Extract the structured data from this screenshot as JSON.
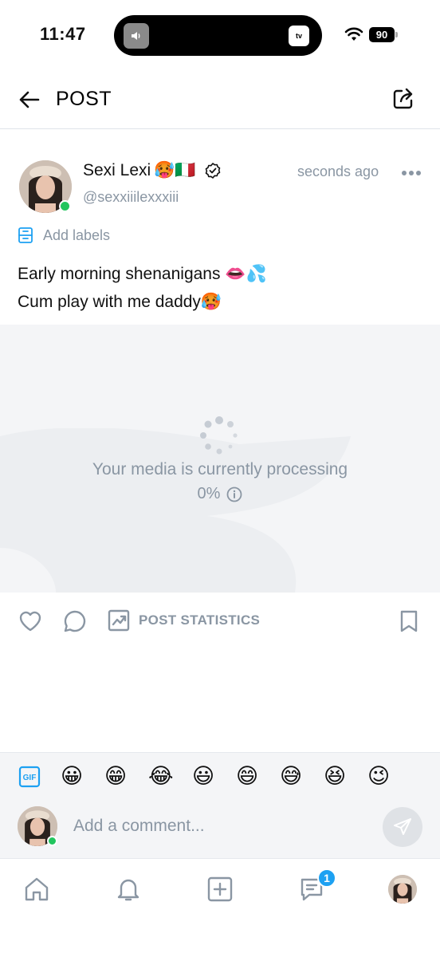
{
  "status_bar": {
    "time": "11:47",
    "battery": "90",
    "tv_label": "tv"
  },
  "header": {
    "title": "POST"
  },
  "post": {
    "display_name": "Sexi Lexi",
    "name_emojis": "🥵🇮🇹",
    "username": "@sexxiiilexxxiii",
    "timestamp": "seconds ago",
    "labels_text": "Add labels",
    "text_line1": "Early morning shenanigans 👄💦",
    "text_line2": "Cum play with me daddy🥵"
  },
  "media": {
    "processing_text": "Your media is currently processing",
    "progress_text": "0%",
    "progress_value": 0
  },
  "actions": {
    "stats_label": "POST STATISTICS"
  },
  "comment": {
    "emojis": [
      "😀",
      "😁",
      "😂",
      "😃",
      "😄",
      "😅",
      "😆",
      "😉"
    ],
    "placeholder": "Add a comment..."
  },
  "nav": {
    "messages_badge": "1"
  },
  "colors": {
    "muted": "#8a96a3",
    "accent": "#1da1f2",
    "online": "#22c55e",
    "media_bg": "#f4f5f7"
  },
  "icons": [
    "back-arrow-icon",
    "share-icon",
    "verified-icon",
    "more-icon",
    "labels-icon",
    "spinner-icon",
    "info-icon",
    "heart-icon",
    "comment-icon",
    "stats-icon",
    "bookmark-icon",
    "gif-icon",
    "send-icon",
    "home-icon",
    "bell-icon",
    "plus-icon",
    "messages-icon"
  ]
}
